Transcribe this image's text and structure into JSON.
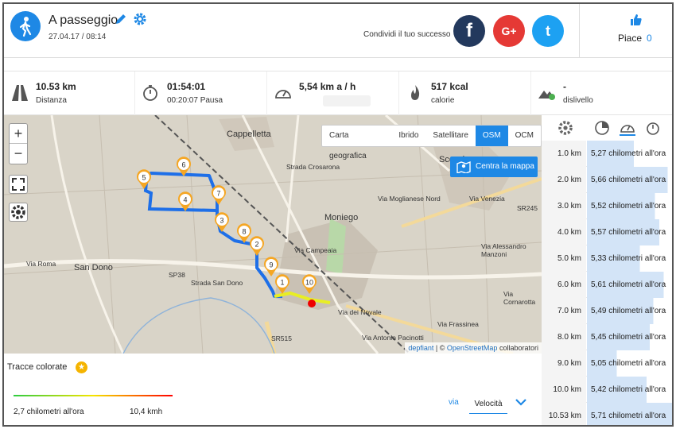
{
  "header": {
    "title": "A passeggio",
    "date": "27.04.17 / 08:14",
    "share_label": "Condividi il tuo successo",
    "social": {
      "facebook": "f",
      "google": "G+",
      "twitter": "t"
    },
    "like_label": "Piace",
    "like_count": "0"
  },
  "stats": [
    {
      "icon": "road-icon",
      "value": "10.53 km",
      "label": "Distanza"
    },
    {
      "icon": "stopwatch-icon",
      "value": "01:54:01",
      "label": "00:20:07 Pausa"
    },
    {
      "icon": "speedometer-icon",
      "value": "5,54 km a / h",
      "label": ""
    },
    {
      "icon": "flame-icon",
      "value": "517 kcal",
      "label": "calorie"
    },
    {
      "icon": "mountain-icon",
      "value": "-",
      "label": "dislivello"
    }
  ],
  "map": {
    "layers": [
      "Carta geografica",
      "Ibrido",
      "Satellitare",
      "OSM",
      "OCM"
    ],
    "active_layer": "OSM",
    "center_button": "Centra la mappa",
    "zoom_in": "+",
    "zoom_out": "−",
    "attribution_leaflet": "depfiant",
    "attribution_sep": "| ©",
    "attribution_osm": "OpenStreetMap",
    "attribution_rest": "collaboratori",
    "place_labels": [
      "Cappelletta",
      "Moniego",
      "San Dono",
      "Scorzè",
      "SP38",
      "Strada San Dono",
      "Via Roma",
      "SR515",
      "Via dei Novale",
      "Via Antonio Pacinotti",
      "Strada Crosarona",
      "Via Moglianese Nord",
      "Via Venezia",
      "SR245",
      "Via Cornarotta",
      "Via Alessandro Manzoni",
      "Via Frassinea",
      "Via Campeaia"
    ],
    "km_markers": [
      "1",
      "2",
      "3",
      "4",
      "5",
      "6",
      "7",
      "8",
      "9",
      "10"
    ]
  },
  "track": {
    "title": "Tracce colorate",
    "legend_min": "2,7 chilometri all'ora",
    "legend_max": "10,4 kmh",
    "via_label": "via",
    "select_value": "Velocità"
  },
  "splits": [
    {
      "km": "1.0 km",
      "speed": "5,27 chilometri all'ora",
      "frac": 0.55
    },
    {
      "km": "2.0 km",
      "speed": "5,66 chilometri all'ora",
      "frac": 0.95
    },
    {
      "km": "3.0 km",
      "speed": "5,52 chilometri all'ora",
      "frac": 0.8
    },
    {
      "km": "4.0 km",
      "speed": "5,57 chilometri all'ora",
      "frac": 0.85
    },
    {
      "km": "5.0 km",
      "speed": "5,33 chilometri all'ora",
      "frac": 0.62
    },
    {
      "km": "6.0 km",
      "speed": "5,61 chilometri all'ora",
      "frac": 0.9
    },
    {
      "km": "7.0 km",
      "speed": "5,49 chilometri all'ora",
      "frac": 0.78
    },
    {
      "km": "8.0 km",
      "speed": "5,45 chilometri all'ora",
      "frac": 0.74
    },
    {
      "km": "9.0 km",
      "speed": "5,05 chilometri all'ora",
      "frac": 0.35
    },
    {
      "km": "10.0 km",
      "speed": "5,42 chilometri all'ora",
      "frac": 0.7
    },
    {
      "km": "10.53 km",
      "speed": "5,71 chilometri all'ora",
      "frac": 1.0
    }
  ]
}
